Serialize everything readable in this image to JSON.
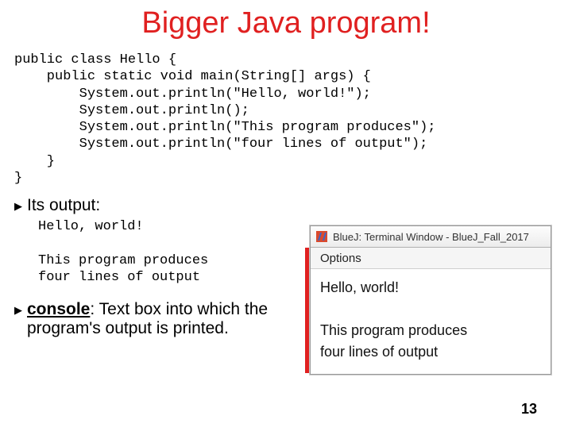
{
  "title": "Bigger Java program!",
  "code": "public class Hello {\n    public static void main(String[] args) {\n        System.out.println(\"Hello, world!\");\n        System.out.println();\n        System.out.println(\"This program produces\");\n        System.out.println(\"four lines of output\");\n    }\n}",
  "bullets": {
    "output_label": "Its output:",
    "console_term": "console",
    "console_def": ": Text box into which the program's output is printed."
  },
  "output_text": "Hello, world!\n\nThis program produces\nfour lines of output",
  "terminal": {
    "title": "BlueJ: Terminal Window - BlueJ_Fall_2017",
    "menu_item": "Options",
    "body": "Hello, world!\n\nThis program produces\nfour lines of output"
  },
  "slide_number": "13"
}
